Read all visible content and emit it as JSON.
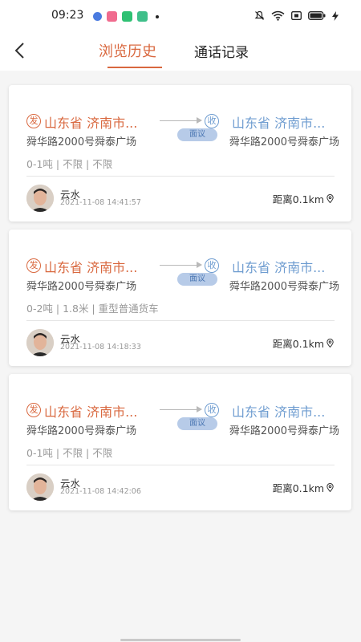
{
  "status_bar": {
    "time": "09:23",
    "left_icons": [
      {
        "name": "notification-icon",
        "color": "#4a7be0"
      },
      {
        "name": "video-app-icon",
        "color": "#f06b8e"
      },
      {
        "name": "app-icon",
        "color": "#2fc173"
      },
      {
        "name": "chat-app-icon",
        "color": "#3fbf8a"
      }
    ],
    "right_icons": [
      "mute-icon",
      "wifi-icon",
      "sim-icon",
      "battery-icon",
      "charging-icon"
    ]
  },
  "header": {
    "back_icon": "chevron-left-icon",
    "tabs": [
      {
        "label": "浏览历史",
        "active": true
      },
      {
        "label": "通话记录",
        "active": false
      }
    ],
    "accent_color": "#d9683f"
  },
  "cards": [
    {
      "origin_badge": "发",
      "origin": "山东省 济南市...",
      "dest_badge": "收",
      "destination": "山东省 济南市...",
      "origin_address": "舜华路2000号舜泰广场",
      "destination_address": "舜华路2000号舜泰广场",
      "price": "面议",
      "specs": "0-1吨 | 不限 | 不限",
      "user_name": "云水",
      "timestamp": "2021-11-08 14:41:57",
      "distance": "距离0.1km"
    },
    {
      "origin_badge": "发",
      "origin": "山东省 济南市...",
      "dest_badge": "收",
      "destination": "山东省 济南市...",
      "origin_address": "舜华路2000号舜泰广场",
      "destination_address": "舜华路2000号舜泰广场",
      "price": "面议",
      "specs": "0-2吨 | 1.8米 | 重型普通货车",
      "user_name": "云水",
      "timestamp": "2021-11-08 14:18:33",
      "distance": "距离0.1km"
    },
    {
      "origin_badge": "发",
      "origin": "山东省 济南市...",
      "dest_badge": "收",
      "destination": "山东省 济南市...",
      "origin_address": "舜华路2000号舜泰广场",
      "destination_address": "舜华路2000号舜泰广场",
      "price": "面议",
      "specs": "0-1吨 | 不限 | 不限",
      "user_name": "云水",
      "timestamp": "2021-11-08 14:42:06",
      "distance": "距离0.1km"
    }
  ],
  "colors": {
    "origin": "#d9683f",
    "destination": "#6e9cd0",
    "badge_bg": "#b7cbe8"
  }
}
